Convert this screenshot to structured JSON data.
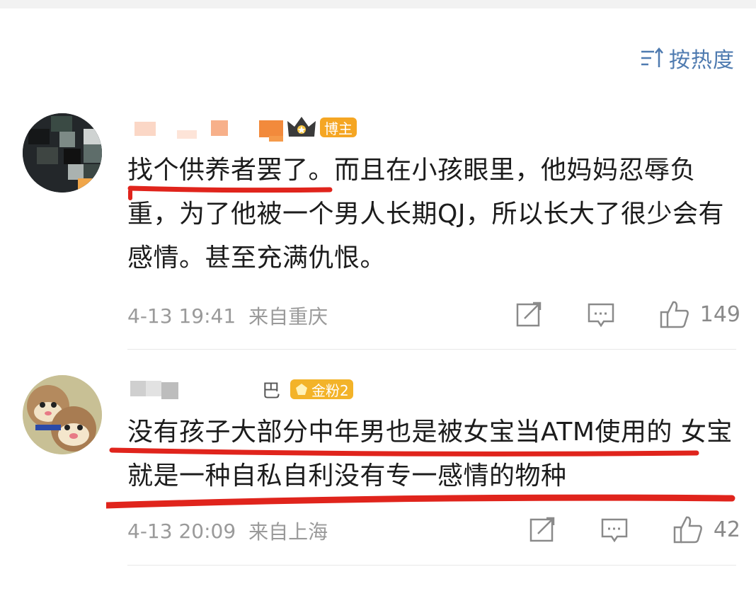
{
  "sort": {
    "label": "按热度",
    "icon": "sort-icon"
  },
  "comments": [
    {
      "badge": "博主",
      "text": "找个供养者罢了。而且在小孩眼里，他妈妈忍辱负重，为了他被一个男人长期QJ，所以长大了很少会有感情。甚至充满仇恨。",
      "time": "4-13 19:41",
      "location": "来自重庆",
      "likes": "149"
    },
    {
      "name_suffix": "巴",
      "badge": "金粉2",
      "text": "没有孩子大部分中年男也是被女宝当ATM使用的 女宝就是一种自私自利没有专一感情的物种",
      "time": "4-13 20:09",
      "location": "来自上海",
      "likes": "42"
    }
  ],
  "colors": {
    "accent": "#4f7bb0",
    "underline": "#e0241c",
    "badge_blogger": "#f5a623",
    "badge_fan": "#f3b329"
  }
}
